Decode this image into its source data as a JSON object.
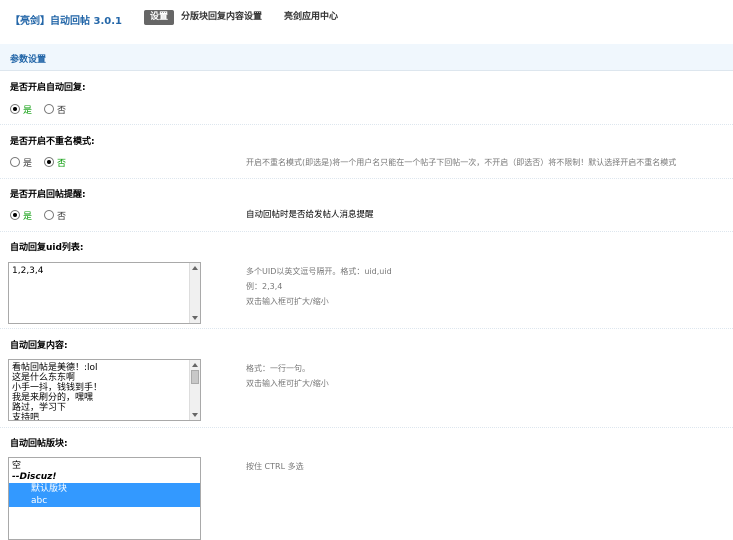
{
  "header": {
    "title": "【亮剑】自动回帖 3.0.1",
    "tabs": [
      "设置",
      "分版块回复内容设置",
      "亮剑应用中心"
    ]
  },
  "section": {
    "title": "参数设置"
  },
  "auto_reply": {
    "label": "是否开启自动回复:",
    "yes": "是",
    "no": "否"
  },
  "no_repeat": {
    "label": "是否开启不重名模式:",
    "yes": "是",
    "no": "否",
    "tip": "开启不重名模式(即选是)将一个用户名只能在一个帖子下回帖一次，不开启（即选否）将不限制！默认选择开启不重名模式"
  },
  "notify": {
    "label": "是否开启回帖提醒:",
    "yes": "是",
    "no": "否",
    "tip": "自动回帖时是否给发帖人消息提醒"
  },
  "uid_list": {
    "label": "自动回复uid列表:",
    "value": "1,2,3,4",
    "tip1": "多个UID以英文逗号隔开。格式：uid,uid",
    "tip2": "例：2,3,4",
    "tip3": "双击输入框可扩大/缩小"
  },
  "reply_content": {
    "label": "自动回复内容:",
    "value": "看帖回帖是美德！:lol\n这是什么东东啊\n小手一抖，钱钱到手！\n我是来刷分的，嘿嘿\n路过，学习下\n支持吧",
    "tip1": "格式：一行一句。",
    "tip2": "双击输入框可扩大/缩小"
  },
  "forums": {
    "label": "自动回帖版块:",
    "options": [
      "空",
      "--Discuz!",
      "默认版块",
      "abc"
    ],
    "tip": "按住 CTRL 多选"
  }
}
